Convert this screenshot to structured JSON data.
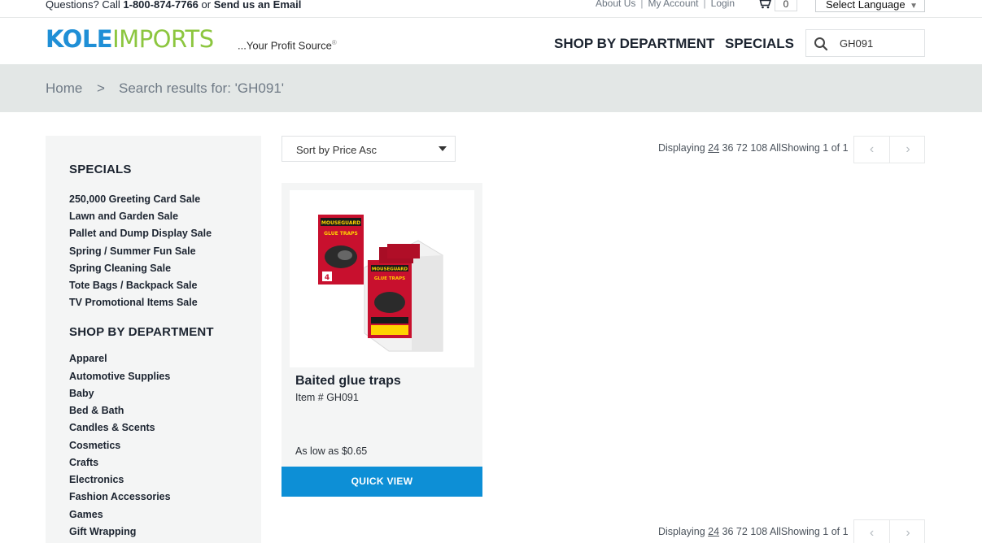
{
  "topbar": {
    "question_prefix": "Questions? Call ",
    "phone": "1-800-874-7766",
    "or": " or ",
    "email_link": "Send us an Email",
    "links": [
      "About Us",
      "My Account",
      "Login"
    ],
    "separator": "|",
    "cart_count": "0",
    "language": "Select Language",
    "language_arrow": "▼"
  },
  "header": {
    "logo_part1": "KOLE",
    "logo_part2": "IMPORTS",
    "tagline": "...Your Profit Source",
    "tagline_mark": "®",
    "nav": [
      "SHOP BY DEPARTMENT",
      "SPECIALS"
    ],
    "search_value": "GH091"
  },
  "breadcrumb": {
    "home": "Home",
    "separator": ">",
    "current": "Search results for: 'GH091'"
  },
  "sidebar": {
    "specials_heading": "SPECIALS",
    "specials": [
      "250,000 Greeting Card Sale",
      "Lawn and Garden Sale",
      "Pallet and Dump Display Sale",
      "Spring / Summer Fun Sale",
      "Spring Cleaning Sale",
      "Tote Bags / Backpack Sale",
      "TV Promotional Items Sale"
    ],
    "departments_heading": "SHOP BY DEPARTMENT",
    "departments": [
      "Apparel",
      "Automotive Supplies",
      "Baby",
      "Bed & Bath",
      "Candles & Scents",
      "Cosmetics",
      "Crafts",
      "Electronics",
      "Fashion Accessories",
      "Games",
      "Gift Wrapping"
    ]
  },
  "toolbar": {
    "sort_label": "Sort by Price Asc",
    "displaying_label": "Displaying ",
    "page_sizes": [
      "24",
      "36",
      "72",
      "108"
    ],
    "all_label": "All",
    "showing": "Showing 1 of 1",
    "prev": "‹",
    "next": "›"
  },
  "product": {
    "title": "Baited glue traps",
    "item_number": "Item # GH091",
    "price": "As low as $0.65",
    "quick_view": "QUICK VIEW",
    "package_text": [
      "MOUSEGUARD",
      "GLUE TRAPS",
      "4"
    ]
  },
  "colors": {
    "brand_blue": "#1f8fd6",
    "brand_green": "#8cc63f",
    "button_blue": "#0d8fd6",
    "breadcrumb_bg": "#e3e7e6",
    "sidebar_bg": "#f4f5f5"
  },
  "icons": [
    "cart-icon",
    "search-icon",
    "chevron-left-icon",
    "chevron-right-icon",
    "dropdown-caret-icon"
  ]
}
